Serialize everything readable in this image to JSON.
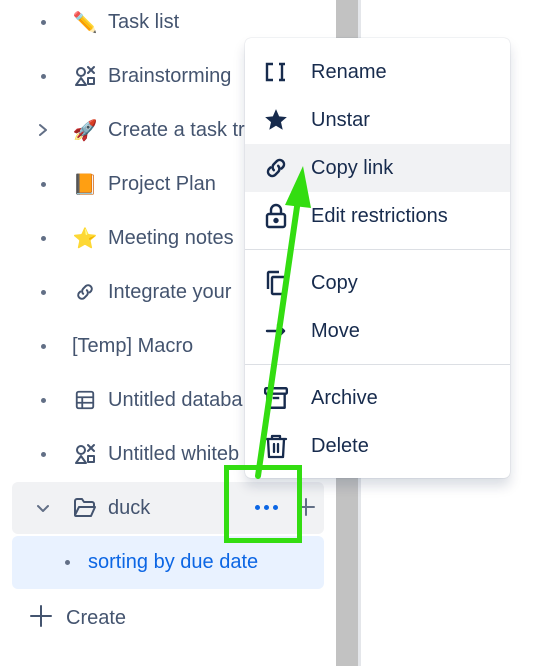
{
  "sidebar": {
    "items": [
      {
        "label": "Task list",
        "icon": "pencil-icon",
        "emoji": "✏️",
        "expandable": false
      },
      {
        "label": "Brainstorming",
        "icon": "whiteboard-icon",
        "expandable": false
      },
      {
        "label": "Create a task tr",
        "icon": "rocket-icon",
        "emoji": "🚀",
        "expandable": true
      },
      {
        "label": "Project Plan",
        "icon": "book-icon",
        "emoji": "📙",
        "expandable": false
      },
      {
        "label": "Meeting notes",
        "icon": "star-emoji-icon",
        "emoji": "⭐",
        "expandable": false
      },
      {
        "label": "Integrate your",
        "icon": "link-icon",
        "expandable": false
      },
      {
        "label": "[Temp] Macro",
        "icon": "",
        "expandable": false
      },
      {
        "label": "Untitled databa",
        "icon": "database-icon",
        "expandable": false
      },
      {
        "label": "Untitled whiteb",
        "icon": "whiteboard-icon",
        "expandable": false
      }
    ],
    "duck": {
      "label": "duck",
      "icon": "folder-open-icon",
      "expanded": true
    },
    "duck_child": {
      "label": "sorting by due date"
    },
    "create_label": "Create"
  },
  "menu": {
    "items": [
      {
        "label": "Rename",
        "icon": "rename-icon"
      },
      {
        "label": "Unstar",
        "icon": "star-filled-icon"
      },
      {
        "label": "Copy link",
        "icon": "link-icon",
        "hover": true
      },
      {
        "label": "Edit restrictions",
        "icon": "lock-icon"
      },
      {
        "label": "Copy",
        "icon": "copy-icon"
      },
      {
        "label": "Move",
        "icon": "arrow-right-icon"
      },
      {
        "label": "Archive",
        "icon": "archive-icon"
      },
      {
        "label": "Delete",
        "icon": "trash-icon"
      }
    ]
  },
  "colors": {
    "text": "#44546f",
    "menu_text": "#172b4d",
    "accent": "#0c66e4",
    "selected_bg": "#e9f2ff",
    "hover_bg": "#f1f2f4",
    "annotation": "#33dd11"
  }
}
